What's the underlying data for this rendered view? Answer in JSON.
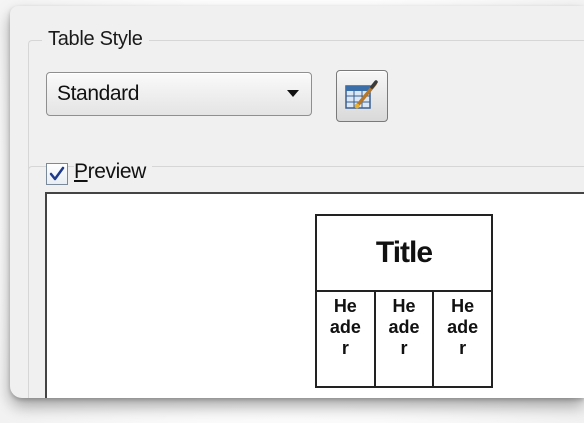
{
  "table_style": {
    "group_label": "Table Style",
    "selected_style": "Standard",
    "edit_icon": "table-style-edit-icon"
  },
  "preview": {
    "checkbox_checked": true,
    "label_first": "P",
    "label_rest": "review",
    "table": {
      "title": "Title",
      "headers": [
        [
          "He",
          "ade",
          "r"
        ],
        [
          "He",
          "ade",
          "r"
        ],
        [
          "He",
          "ade",
          "r"
        ]
      ]
    }
  }
}
